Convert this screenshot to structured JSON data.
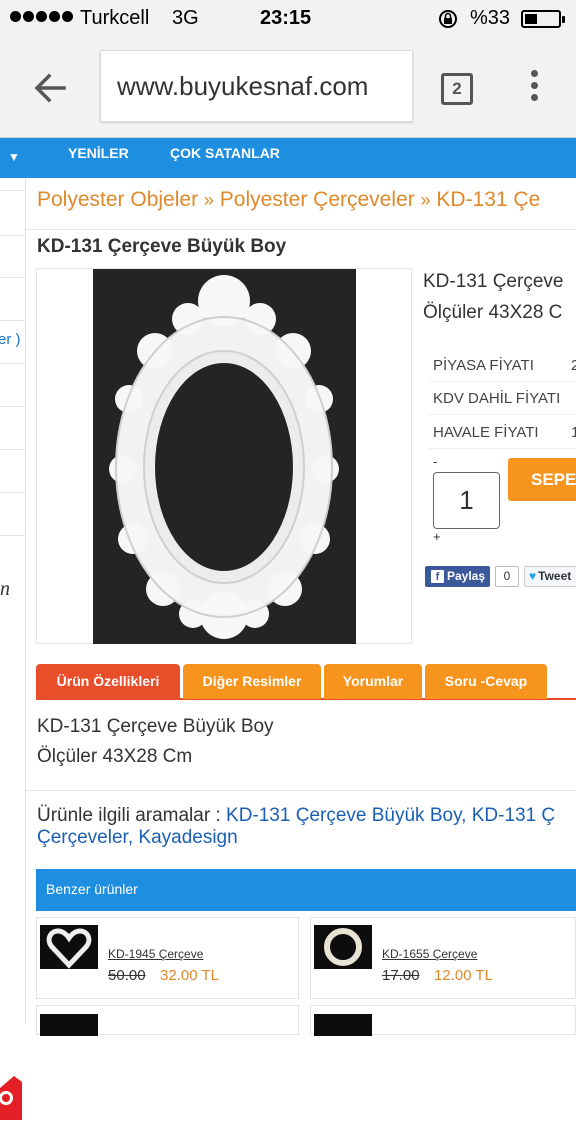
{
  "status_bar": {
    "carrier": "Turkcell",
    "network": "3G",
    "time": "23:15",
    "battery": "%33"
  },
  "browser": {
    "url": "www.buyukesnaf.com",
    "tab_count": "2"
  },
  "nav": {
    "items": [
      "YENİLER",
      "ÇOK SATANLAR"
    ]
  },
  "sidebar": {
    "partial_text": "er )",
    "partial_glyph": "n"
  },
  "breadcrumb": {
    "items": [
      "Polyester Objeler",
      "Polyester Çerçeveler",
      "KD-131 Çe"
    ],
    "separator": "»"
  },
  "product": {
    "title": "KD-131 Çerçeve Büyük Boy",
    "name_short": "KD-131 Çerçeve",
    "size_short": "Ölçüler 43X28 C",
    "price_rows": [
      {
        "label": "PİYASA FİYATI",
        "value": "2"
      },
      {
        "label": "KDV DAHİL FİYATI",
        "value": ""
      },
      {
        "label": "HAVALE FİYATI",
        "value": "1"
      }
    ],
    "qty_minus": "-",
    "quantity": "1",
    "qty_plus": "+",
    "cart_label": "SEPE",
    "share_label": "Paylaş",
    "share_count": "0",
    "tweet_label": "Tweet"
  },
  "tabs": [
    "Ürün Özellikleri",
    "Diğer Resimler",
    "Yorumlar",
    "Soru -Cevap"
  ],
  "description": {
    "line1": "KD-131 Çerçeve Büyük Boy",
    "line2": "Ölçüler 43X28 Cm"
  },
  "related_searches": {
    "label": "Ürünle ilgili aramalar :",
    "links": [
      "KD-131 Çerçeve Büyük Boy,",
      "KD-131 Ç",
      "Çerçeveler,",
      "Kayadesign"
    ]
  },
  "similar": {
    "header": "Benzer ürünler",
    "products": [
      {
        "name": "KD-1945 Çerçeve",
        "old_price": "50.00",
        "price": "32.00 TL"
      },
      {
        "name": "KD-1655 Çerçeve",
        "old_price": "17.00",
        "price": "12.00 TL"
      }
    ]
  },
  "colors": {
    "brand_blue": "#1e8fe0",
    "accent_orange": "#f7941d",
    "active_tab_red": "#e94e2a",
    "breadcrumb_orange": "#e0892a",
    "link_blue": "#1a5fb4"
  }
}
